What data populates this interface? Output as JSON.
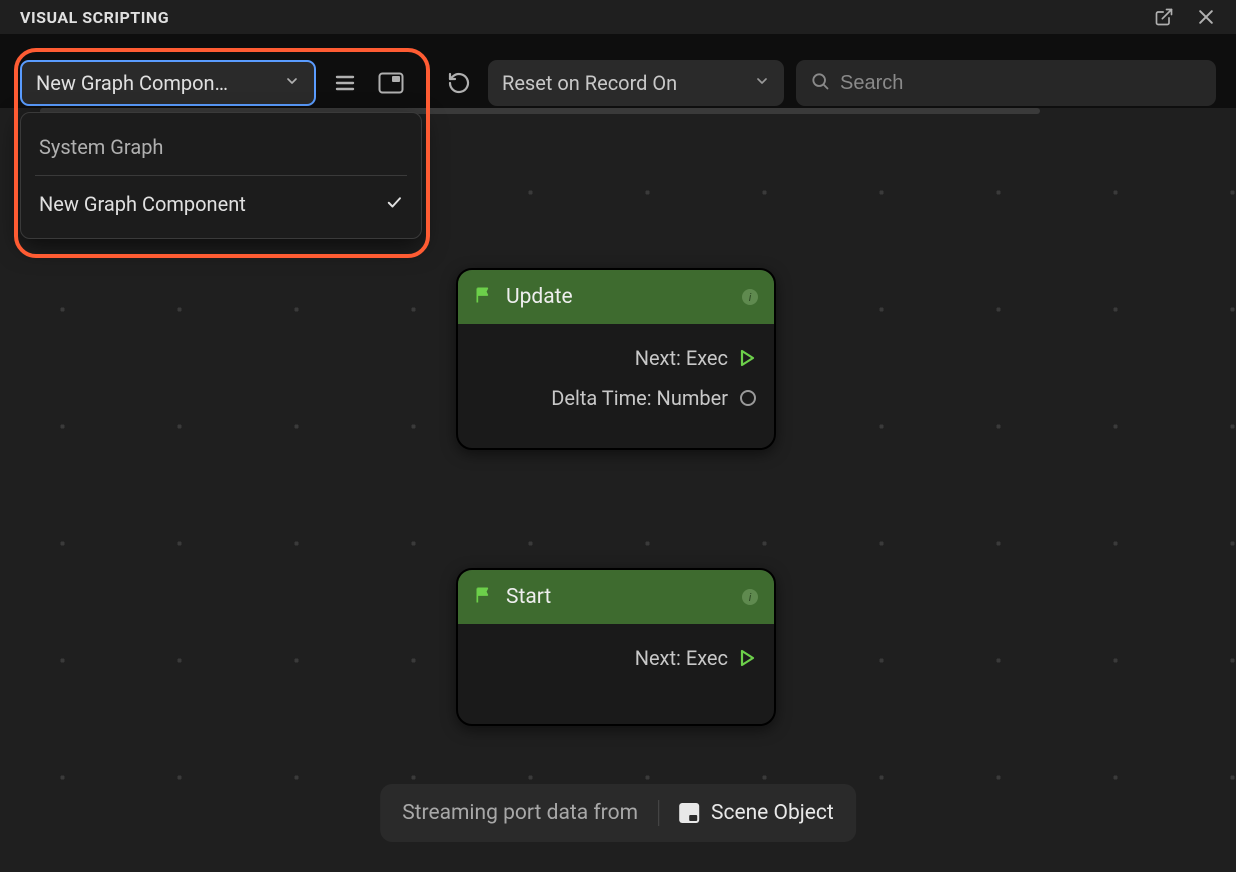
{
  "header": {
    "title": "VISUAL SCRIPTING"
  },
  "toolbar": {
    "graph_selector_label": "New Graph Compon…",
    "reset_label": "Reset on Record On",
    "search_placeholder": "Search"
  },
  "dropdown_menu": {
    "items": [
      {
        "label": "System Graph",
        "selected": false
      },
      {
        "label": "New Graph Component",
        "selected": true
      }
    ]
  },
  "nodes": {
    "update": {
      "title": "Update",
      "ports": [
        {
          "label": "Next: Exec",
          "kind": "exec"
        },
        {
          "label": "Delta Time: Number",
          "kind": "data"
        }
      ]
    },
    "start": {
      "title": "Start",
      "ports": [
        {
          "label": "Next: Exec",
          "kind": "exec"
        }
      ]
    }
  },
  "footer": {
    "prefix": "Streaming port data from",
    "object": "Scene Object"
  }
}
